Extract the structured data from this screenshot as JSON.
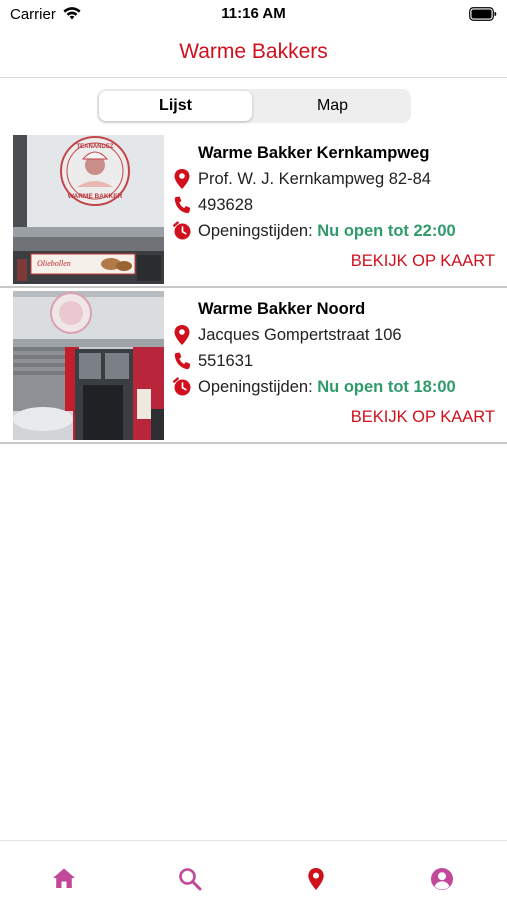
{
  "status_bar": {
    "carrier": "Carrier",
    "time": "11:16 AM"
  },
  "header": {
    "title": "Warme Bakkers"
  },
  "segments": {
    "list_label": "Lijst",
    "map_label": "Map",
    "selected": "Lijst"
  },
  "bakeries": [
    {
      "name": "Warme Bakker Kernkampweg",
      "address": "Prof. W. J. Kernkampweg 82-84",
      "phone": "493628",
      "hours_label": "Openingstijden:",
      "hours_status": "Nu open tot 22:00",
      "map_link": "BEKIJK OP KAART",
      "thumb_signage": [
        "TEANANDEZ",
        "WARME BAKKER",
        "Oliebollen"
      ]
    },
    {
      "name": "Warme Bakker Noord",
      "address": "Jacques Gompertstraat 106",
      "phone": "551631",
      "hours_label": "Openingstijden:",
      "hours_status": "Nu open tot 18:00",
      "map_link": "BEKIJK OP KAART"
    }
  ],
  "tab_bar": {
    "tabs": [
      {
        "icon": "home-icon",
        "active": false
      },
      {
        "icon": "search-icon",
        "active": false
      },
      {
        "icon": "location-pin-icon",
        "active": true
      },
      {
        "icon": "profile-icon",
        "active": false
      }
    ]
  },
  "colors": {
    "brand_red": "#d0101d",
    "open_green": "#2f9b6b",
    "tab_pink": "#c2489a"
  }
}
